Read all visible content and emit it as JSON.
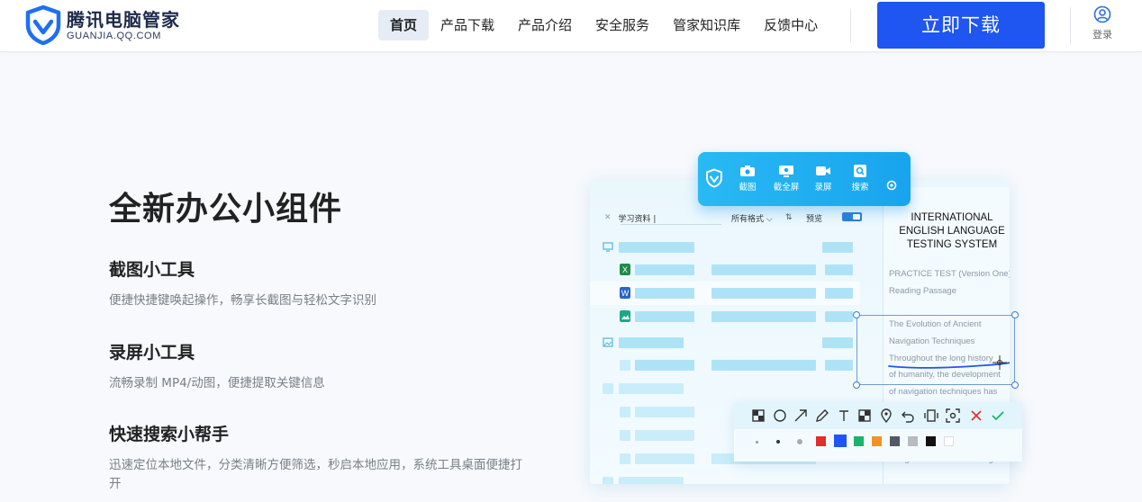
{
  "header": {
    "logo_title": "腾讯电脑管家",
    "logo_sub": "GUANJIA.QQ.COM",
    "nav": [
      "首页",
      "产品下载",
      "产品介绍",
      "安全服务",
      "管家知识库",
      "反馈中心"
    ],
    "active_nav": "首页",
    "download_label": "立即下载",
    "login_label": "登录",
    "brand_color": "#1f55f0"
  },
  "hero": {
    "title": "全新办公小组件",
    "features": [
      {
        "title": "截图小工具",
        "desc": "便捷快捷键唤起操作，畅享长截图与轻松文字识别"
      },
      {
        "title": "录屏小工具",
        "desc": "流畅录制 MP4/动图，便捷提取关键信息"
      },
      {
        "title": "快速搜索小帮手",
        "desc": "迅速定位本地文件，分类清晰方便筛选，秒启本地应用，系统工具桌面便捷打开"
      }
    ]
  },
  "illustration": {
    "toolbar": [
      "截图",
      "截全屏",
      "录屏",
      "搜索"
    ],
    "search_text": "学习资料 |",
    "filter_label": "所有格式 ⌵",
    "sort_label": "⇅",
    "preview_label": "预览",
    "doc": {
      "title": "INTERNATIONAL ENGLISH LANGUAGE TESTING SYSTEM",
      "lines": [
        "PRACTICE TEST (Version One)",
        "Reading Passage",
        "The Evolution of Ancient",
        "Navigation Techniques",
        "Throughout the long history",
        "of humanity, the development",
        "of navigation techniques has",
        "navigation to later inventing..."
      ]
    },
    "draw_tools": [
      "mosaic-tool",
      "circle-tool",
      "arrow-tool",
      "pencil-tool",
      "text-tool",
      "blur-tool",
      "pin-tool",
      "undo-tool",
      "long-screenshot-tool",
      "ocr-tool",
      "cancel-tool",
      "confirm-tool"
    ],
    "palette": [
      "#e02d2d",
      "#1f55f0",
      "#19b46b",
      "#f0922a",
      "#505a66",
      "#b8bcc2",
      "#111111",
      "#ffffff"
    ]
  }
}
